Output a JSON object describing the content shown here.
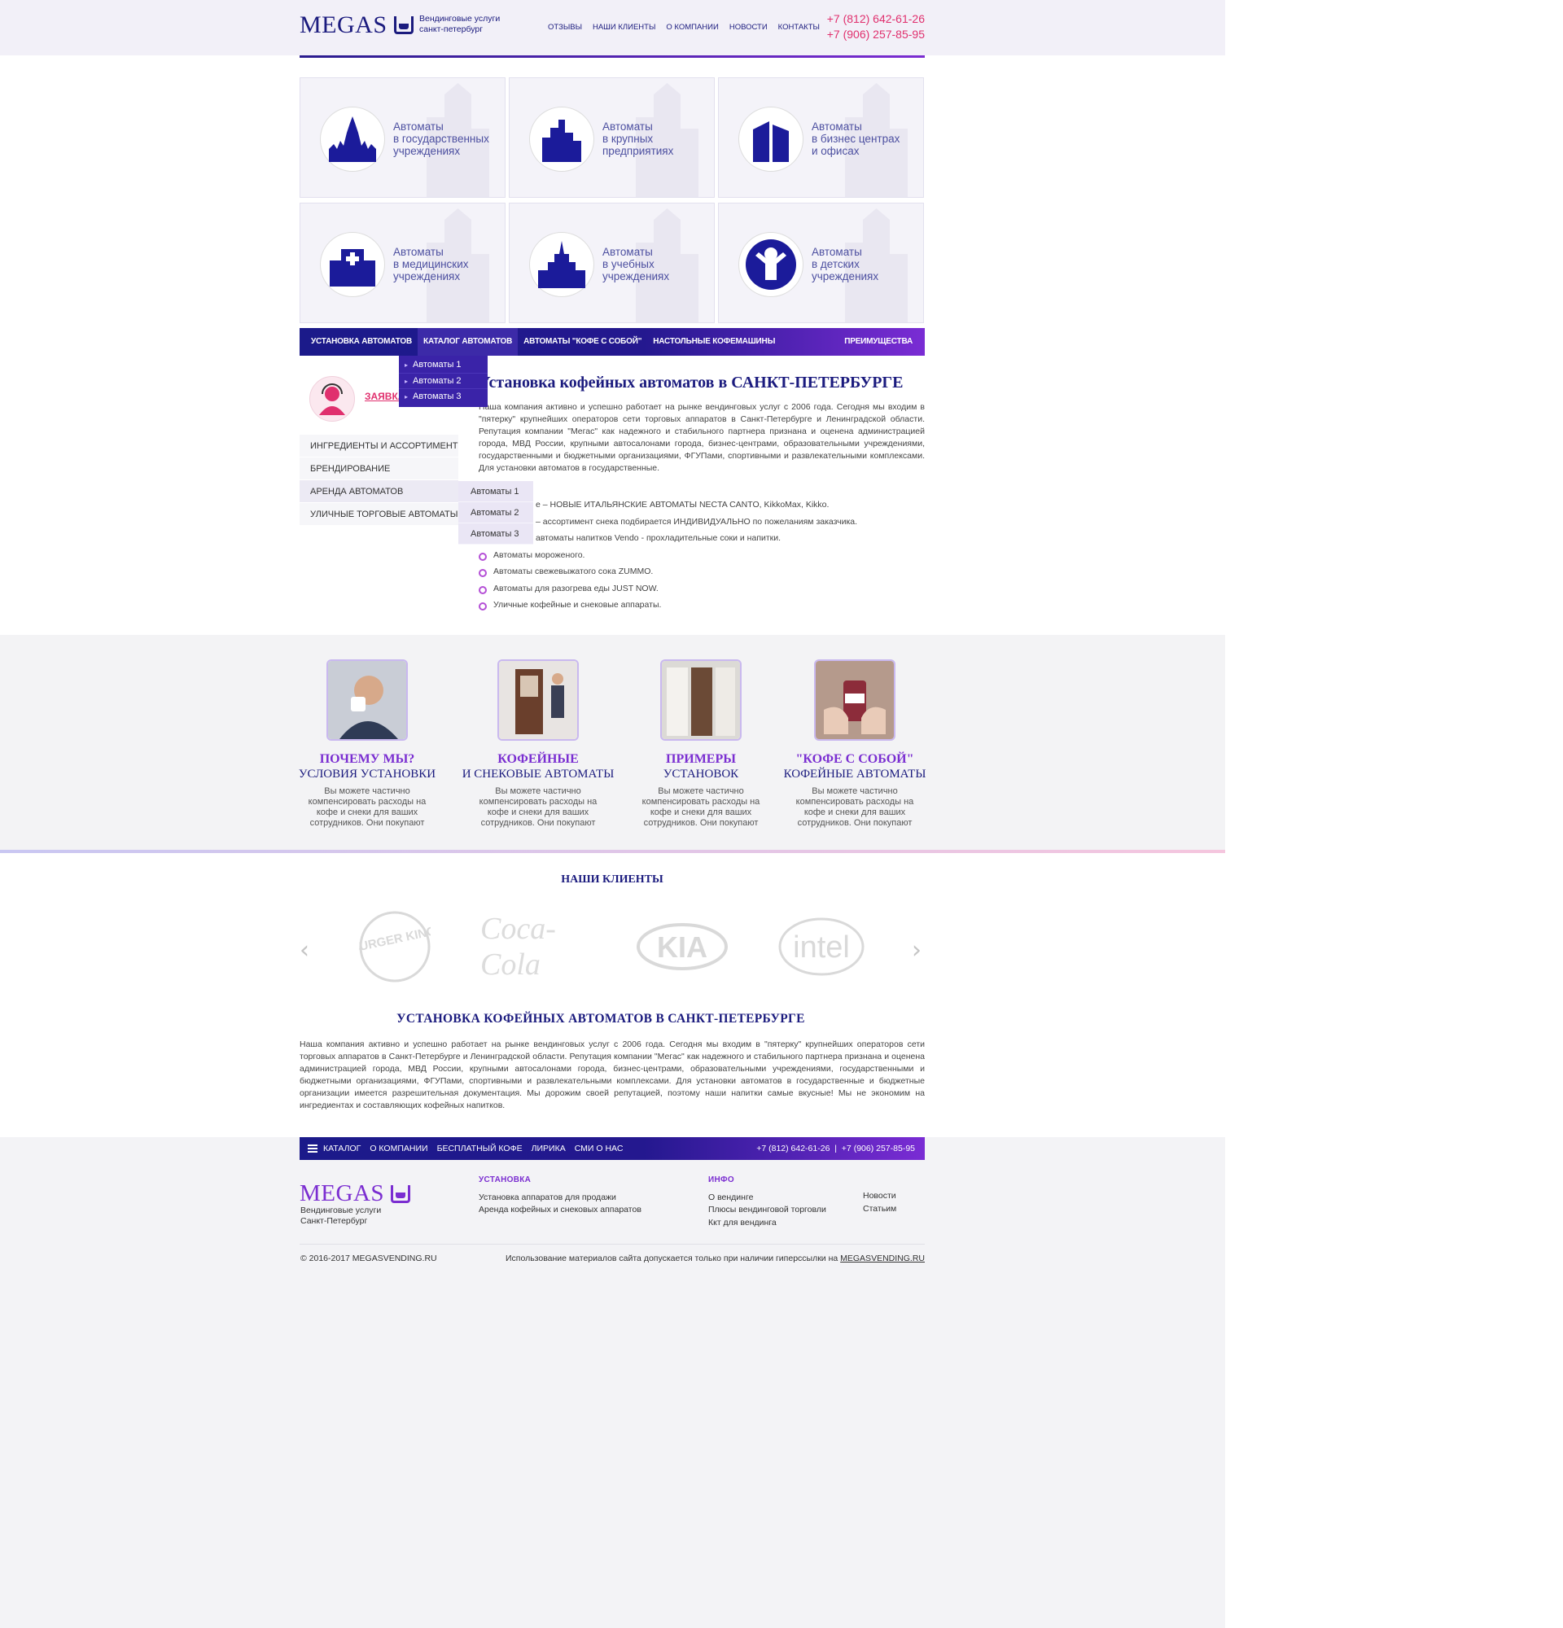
{
  "header": {
    "logo_text": "MEGAS",
    "tagline_1": "Вендинговые услуги",
    "tagline_2": "санкт-петербург",
    "nav": [
      "ОТЗЫВЫ",
      "НАШИ КЛИЕНТЫ",
      "О КОМПАНИИ",
      "НОВОСТИ",
      "КОНТАКТЫ"
    ],
    "phone_1": "+7 (812) 642-61-26",
    "phone_2": "+7 (906) 257-85-95"
  },
  "tiles": [
    {
      "l1": "Автоматы",
      "l2": "в государственных",
      "l3": "учреждениях",
      "icon": "kremlin-icon"
    },
    {
      "l1": "Автоматы",
      "l2": "в крупных",
      "l3": "предприятиях",
      "icon": "factory-icon"
    },
    {
      "l1": "Автоматы",
      "l2": "в бизнес центрах",
      "l3": "и офисах",
      "icon": "office-building-icon"
    },
    {
      "l1": "Автоматы",
      "l2": "в медицинских",
      "l3": "учреждениях",
      "icon": "hospital-icon"
    },
    {
      "l1": "Автоматы",
      "l2": "в учебных",
      "l3": "учреждениях",
      "icon": "university-icon"
    },
    {
      "l1": "Автоматы",
      "l2": "в детских",
      "l3": "учреждениях",
      "icon": "child-icon"
    }
  ],
  "catalog_nav": {
    "items": [
      "УСТАНОВКА АВТОМАТОВ",
      "КАТАЛОГ АВТОМАТОВ",
      "АВТОМАТЫ \"КОФЕ С СОБОЙ\"",
      "НАСТОЛЬНЫЕ КОФЕМАШИНЫ"
    ],
    "right": "ПРЕИМУЩЕСТВА",
    "dropdown": [
      "Автоматы 1",
      "Автоматы 2",
      "Автоматы 3"
    ]
  },
  "sidebar": {
    "order_label": "ЗАЯВКА",
    "menu": [
      "ИНГРЕДИЕНТЫ И АССОРТИМЕНТ",
      "БРЕНДИРОВАНИЕ",
      "АРЕНДА АВТОМАТОВ",
      "УЛИЧНЫЕ ТОРГОВЫЕ АВТОМАТЫ"
    ],
    "submenu": [
      "Автоматы 1",
      "Автоматы 2",
      "Автоматы 3"
    ]
  },
  "main": {
    "title": "Установка кофейных автоматов в САНКТ-ПЕТЕРБУРГЕ",
    "paragraph": "Наша компания активно и успешно работает на рынке вендинговых услуг с 2006 года. Сегодня мы входим в \"пятерку\" крупнейших операторов сети торговых аппаратов в Санкт-Петербурге и Ленинградской области. Репутация компании \"Мегас\" как надежного и стабильного партнера признана и оценена администрацией города, МВД России, крупными автосалонами города, бизнес-центрами, образовательными учреждениями, государственными и бюджетными организациями, ФГУПами, спортивными и развлекательными комплексами. Для установки автоматов в государственные.",
    "bullets": [
      "е – НОВЫЕ ИТАЛЬЯНСКИЕ АВТОМАТЫ NECTA CANTO, KikkoMax, Kikko.",
      "– ассортимент снека подбирается ИНДИВИДУАЛЬНО по пожеланиям заказчика.",
      "автоматы напитков Vendo - прохладительные соки и напитки.",
      "Автоматы мороженого.",
      "Автоматы свежевыжатого сока ZUMMO.",
      "Автоматы для разогрева еды JUST NOW.",
      "Уличные кофейные и снековые аппараты."
    ]
  },
  "features": [
    {
      "t1": "ПОЧЕМУ МЫ?",
      "t2": "УСЛОВИЯ УСТАНОВКИ",
      "d": "Вы можете частично компенсировать расходы на кофе и снеки для ваших сотрудников. Они покупают"
    },
    {
      "t1": "КОФЕЙНЫЕ",
      "t2": "И СНЕКОВЫЕ АВТОМАТЫ",
      "d": "Вы можете частично компенсировать расходы на кофе и снеки для ваших сотрудников. Они покупают"
    },
    {
      "t1": "ПРИМЕРЫ",
      "t2": "УСТАНОВОК",
      "d": "Вы можете частично компенсировать расходы на кофе и снеки для ваших сотрудников. Они покупают"
    },
    {
      "t1": "\"КОФЕ С СОБОЙ\"",
      "t2": "КОФЕЙНЫЕ АВТОМАТЫ",
      "d": "Вы можете частично компенсировать расходы на кофе и снеки для ваших сотрудников. Они покупают"
    }
  ],
  "clients": {
    "title": "НАШИ КЛИЕНТЫ",
    "logos": [
      "BURGER KING",
      "Coca-Cola",
      "KIA",
      "intel"
    ]
  },
  "seo": {
    "title": "УСТАНОВКА КОФЕЙНЫХ АВТОМАТОВ В САНКТ-ПЕТЕРБУРГЕ",
    "paragraph": "Наша компания активно и успешно работает на рынке вендинговых услуг с 2006 года. Сегодня мы входим в \"пятерку\" крупнейших операторов сети торговых аппаратов в Санкт-Петербурге и Ленинградской области. Репутация компании \"Мегас\" как надежного и стабильного партнера признана и оценена администрацией города, МВД России, крупными автосалонами города, бизнес-центрами, образовательными учреждениями, государственными и бюджетными организациями, ФГУПами, спортивными и развлекательными комплексами. Для установки автоматов в государственные и бюджетные организации имеется разрешительная документация. Мы дорожим своей репутацией, поэтому наши напитки самые вкусные! Мы не экономим на ингредиентах и составляющих кофейных напитков."
  },
  "footer": {
    "nav": [
      "КАТАЛОГ",
      "О КОМПАНИИ",
      "БЕСПЛАТНЫЙ КОФЕ",
      "ЛИРИКА",
      "СМИ О НАС"
    ],
    "phones": "+7 (812) 642-61-26  |  +7 (906) 257-85-95",
    "logo_text": "MEGAS",
    "tagline_1": "Вендинговые услуги",
    "tagline_2": "Санкт-Петербург",
    "col1_title": "УСТАНОВКА",
    "col1_links": [
      "Установка аппаратов для продажи",
      "Аренда кофейных и снековых аппаратов"
    ],
    "col2_title": "ИНФО",
    "col2_links": [
      "О вендинге",
      "Плюсы вендинговой торговли",
      "Ккт для вендинга"
    ],
    "col3_links": [
      "Новости",
      "Статьим"
    ],
    "copyright": "© 2016-2017 MEGASVENDING.RU",
    "legal": "Использование материалов сайта допускается только при наличии гиперссылки на",
    "legal_link": "MEGASVENDING.RU"
  },
  "colors": {
    "brand_blue": "#1b1b7e",
    "accent_purple": "#7b2ed1",
    "phone_pink": "#e0306e"
  }
}
